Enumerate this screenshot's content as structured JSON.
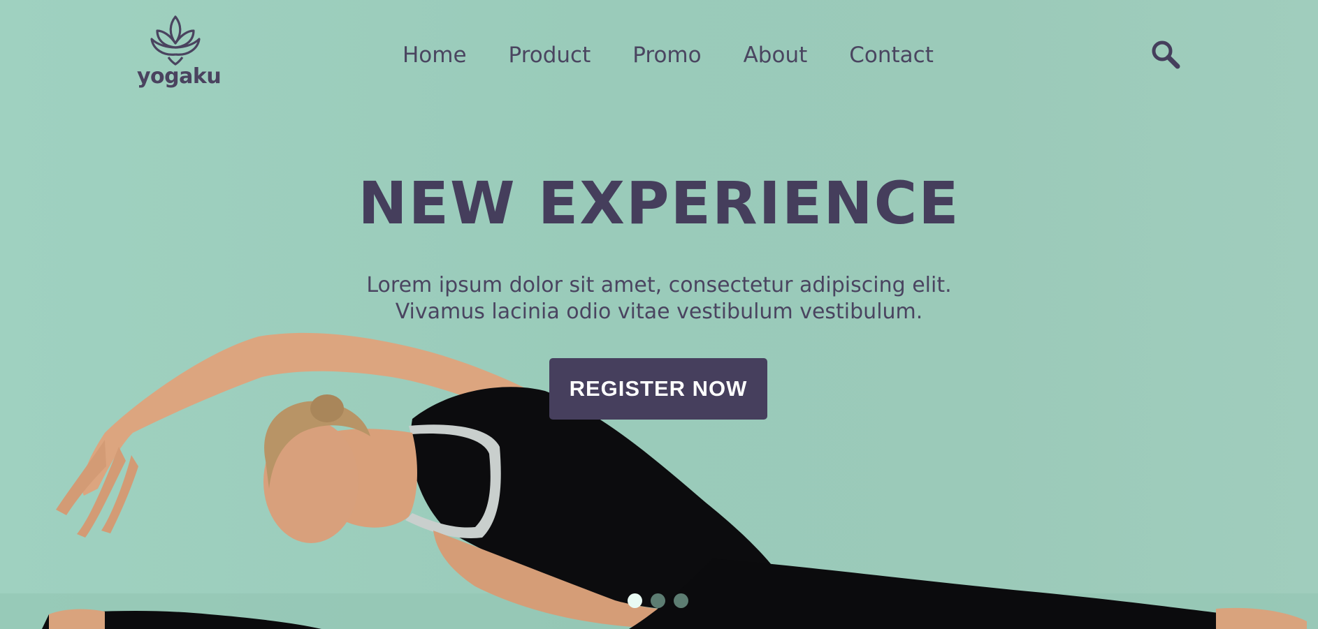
{
  "brand": {
    "name": "yogaku",
    "accent": "#463f5d",
    "background": "#9dcdbc"
  },
  "nav": {
    "items": [
      {
        "label": "Home"
      },
      {
        "label": "Product"
      },
      {
        "label": "Promo"
      },
      {
        "label": "About"
      },
      {
        "label": "Contact"
      }
    ],
    "search_icon": "search-icon"
  },
  "hero": {
    "headline": "NEW EXPERIENCE",
    "subtext_line1": "Lorem ipsum dolor sit amet, consectetur adipiscing elit.",
    "subtext_line2": "Vivamus lacinia odio vitae vestibulum vestibulum.",
    "cta_label": "REGISTER NOW",
    "image": "woman-in-black-doing-side-split-stretch"
  },
  "carousel": {
    "slide_count": 3,
    "active_index": 0
  }
}
